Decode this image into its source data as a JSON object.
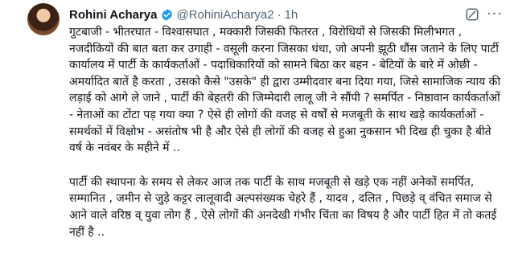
{
  "author": {
    "name": "Rohini Acharya",
    "handle": "@RohiniAcharya2",
    "separator": "·",
    "time": "1h",
    "avatar_icon": "profile-photo",
    "verified_icon": "verified-badge-icon",
    "verified_color": "#1d9bf0"
  },
  "actions": {
    "grok_icon": "grok-icon",
    "more_label": "···"
  },
  "tweet": {
    "paragraphs": [
      "गुटबाजी - भीतरघात - विश्वासघात , मक्कारी जिसकी फितरत , विरोधियों से जिसकी मिलीभगत , नजदीकियों की बात बता कर उगाही - वसूली करना जिसका धंधा, जो अपनी झूठी धौंस जताने के लिए पार्टी कार्यालय में पार्टी के कार्यकर्ताओं - पदाधिकारियों को सामने बिठा कर बहन - बेटियों के बारे में ओछी - अमर्यादित बातें है करता , उसको कैसे \"उसके\" ही द्वारा उम्मीदवार बना दिया गया, जिसे सामाजिक न्याय की लड़ाई को आगे ले जाने , पार्टी की बेहतरी की जिम्मेदारी लालू जी ने सौंपी ? समर्पित - निष्ठावान कार्यकर्ताओं - नेताओं का टोंटा पड़ गया क्या ? ऐसे ही लोगों की वजह से वर्षों से मजबूती के साथ खड़े कार्यकर्ताओं - समर्थकों में विक्षोभ - असंतोष भी है और ऐसे ही लोगों की वजह से हुआ नुकसान भी दिख ही चुका है बीते वर्ष के नवंबर के महीने में ..",
      "पार्टी की स्थापना के समय से लेकर आज तक पार्टी के साथ मजबूती से खड़े एक नहीं अनेकों समर्पित, सम्मानित , जमीन से जुड़े कट्टर लालूवादी अल्पसंख्यक चेहरे हैं , यादव , दलित , पिछड़े व् वंचित समाज से आने वाले वरिष्ठ व् युवा लोग हैं , ऐसे लोगों की अनदेखी गंभीर चिंता का विषय है और पार्टी हित में तो कतई नहीं है .."
    ]
  }
}
